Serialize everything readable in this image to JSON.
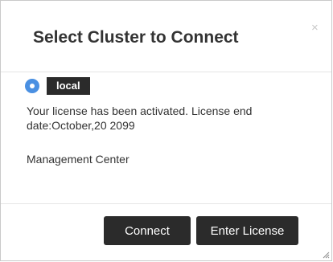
{
  "dialog": {
    "title": "Select Cluster to Connect",
    "close_label": "×"
  },
  "cluster": {
    "name": "local",
    "selected": true,
    "license_message": "Your license has been activated. License end date:October,20 2099",
    "product": "Management Center"
  },
  "footer": {
    "connect_label": "Connect",
    "enter_license_label": "Enter License"
  },
  "colors": {
    "radio_accent": "#4a90e2",
    "button_bg": "#2b2b2b",
    "badge_bg": "#2b2b2b"
  }
}
